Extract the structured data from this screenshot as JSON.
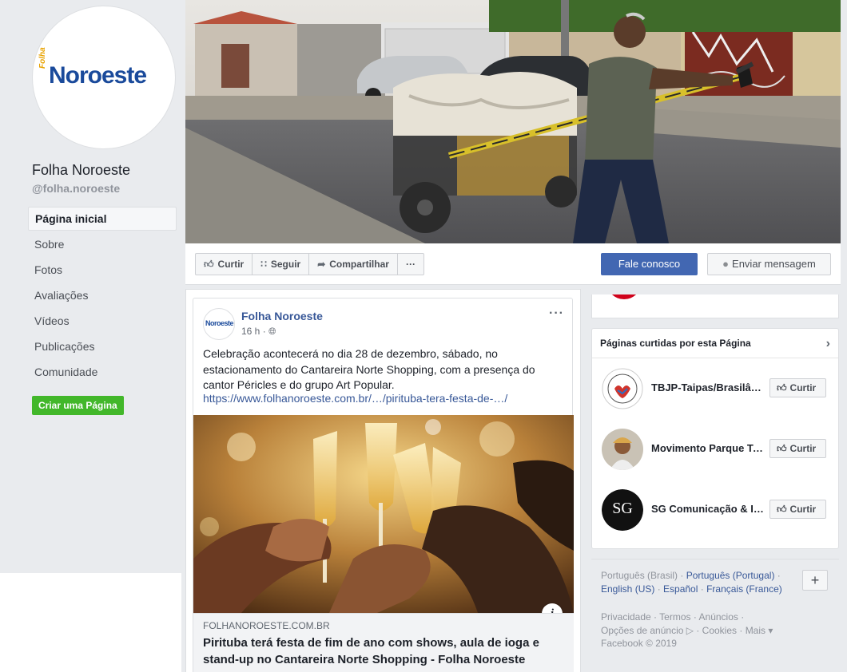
{
  "page": {
    "logo_prefix": "Folha",
    "logo_text": "Noroeste",
    "name": "Folha Noroeste",
    "handle": "@folha.noroeste"
  },
  "nav": {
    "items": [
      {
        "label": "Página inicial",
        "active": true
      },
      {
        "label": "Sobre"
      },
      {
        "label": "Fotos"
      },
      {
        "label": "Avaliações"
      },
      {
        "label": "Vídeos"
      },
      {
        "label": "Publicações"
      },
      {
        "label": "Comunidade"
      }
    ],
    "create_page": "Criar uma Página"
  },
  "actions": {
    "like": "Curtir",
    "follow": "Seguir",
    "share": "Compartilhar",
    "more": "···",
    "contact": "Fale conosco",
    "message": "Enviar mensagem"
  },
  "post": {
    "avatar_text": "Noroeste",
    "author": "Folha Noroeste",
    "time": "16 h ·",
    "more": "···",
    "text": "Celebração acontecerá no dia 28 de dezembro, sábado, no estacionamento do Cantareira Norte Shopping, com a presença do cantor Péricles e do grupo Art Popular.",
    "link": "https://www.folhanoroeste.com.br/…/pirituba-tera-festa-de-…/",
    "info_icon": "i",
    "preview_domain": "FOLHANOROESTE.COM.BR",
    "preview_title": "Pirituba terá festa de fim de ano com shows, aula de ioga e stand-up no Cantareira Norte Shopping - Folha Noroeste"
  },
  "liked_pages": {
    "header": "Páginas curtidas por esta Página",
    "like_label": "Curtir",
    "items": [
      {
        "name": "TBJP-Taipas/Brasilândia..."
      },
      {
        "name": "Movimento Parque Taipas"
      },
      {
        "name": "SG Comunicação & Imagem"
      }
    ]
  },
  "languages": {
    "current": "Português (Brasil)",
    "options": [
      "Português (Portugal)",
      "English (US)",
      "Español",
      "Français (France)"
    ],
    "add": "+"
  },
  "footer": {
    "links": [
      "Privacidade",
      "Termos",
      "Anúncios",
      "Opções de anúncio",
      "Cookies",
      "Mais"
    ],
    "copyright": "Facebook © 2019"
  },
  "colors": {
    "brand_blue": "#4267b2",
    "link_blue": "#385898",
    "create_green": "#42b72a",
    "bg": "#e9ebee"
  }
}
